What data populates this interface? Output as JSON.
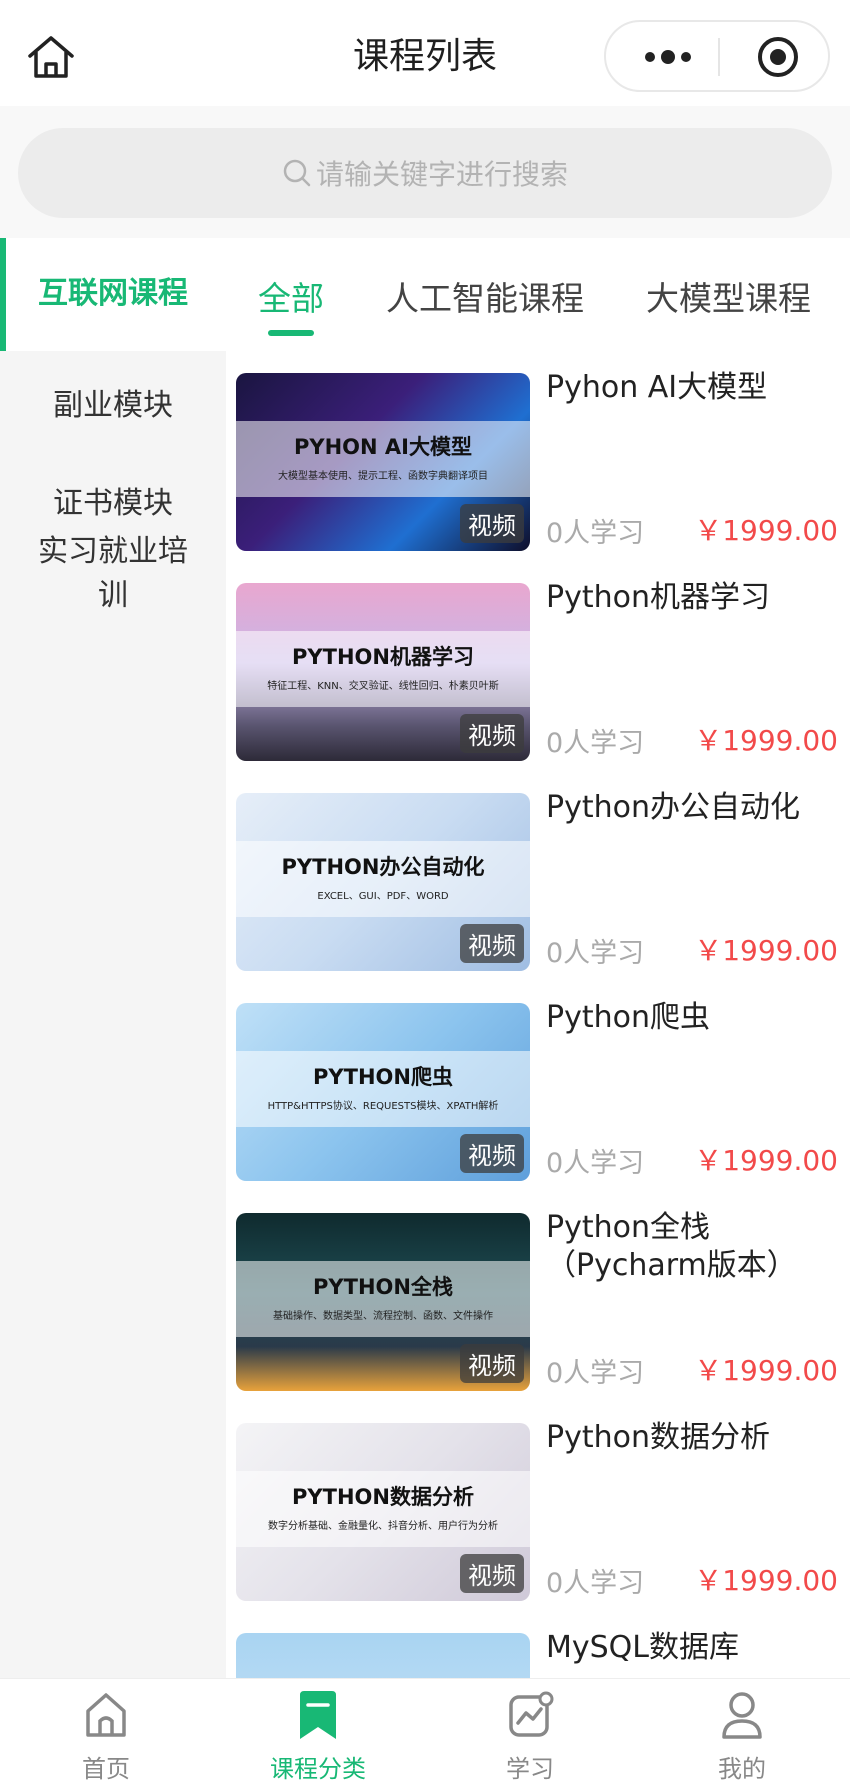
{
  "header": {
    "title": "课程列表"
  },
  "search": {
    "placeholder": "请输关键字进行搜索"
  },
  "sidebar": {
    "active": "互联网课程",
    "items": [
      "副业模块",
      "证书模块",
      "实习就业培训"
    ]
  },
  "subtabs": [
    "全部",
    "人工智能课程",
    "大模型课程"
  ],
  "courses": [
    {
      "title": "Pyhon AI大模型",
      "thumb_title": "PYHON AI大模型",
      "thumb_sub": "大模型基本使用、提示工程、函数字典翻译项目",
      "badge": "视频",
      "students": "0人学习",
      "price": "￥1999.00"
    },
    {
      "title": "Python机器学习",
      "thumb_title": "PYTHON机器学习",
      "thumb_sub": "特征工程、KNN、交叉验证、线性回归、朴素贝叶斯",
      "badge": "视频",
      "students": "0人学习",
      "price": "￥1999.00"
    },
    {
      "title": "Python办公自动化",
      "thumb_title": "PYTHON办公自动化",
      "thumb_sub": "EXCEL、GUI、PDF、WORD",
      "badge": "视频",
      "students": "0人学习",
      "price": "￥1999.00"
    },
    {
      "title": "Python爬虫",
      "thumb_title": "PYTHON爬虫",
      "thumb_sub": "HTTP&HTTPS协议、REQUESTS模块、XPATH解析",
      "badge": "视频",
      "students": "0人学习",
      "price": "￥1999.00"
    },
    {
      "title": "Python全栈（Pycharm版本）",
      "thumb_title": "PYTHON全栈",
      "thumb_sub": "基础操作、数据类型、流程控制、函数、文件操作",
      "badge": "视频",
      "students": "0人学习",
      "price": "￥1999.00"
    },
    {
      "title": "Python数据分析",
      "thumb_title": "PYTHON数据分析",
      "thumb_sub": "数字分析基础、金融量化、抖音分析、用户行为分析",
      "badge": "视频",
      "students": "0人学习",
      "price": "￥1999.00"
    },
    {
      "title": "MySQL数据库",
      "thumb_title": "",
      "thumb_sub": "",
      "badge": "",
      "students": "",
      "price": ""
    }
  ],
  "tabbar": [
    "首页",
    "课程分类",
    "学习",
    "我的"
  ],
  "colors": {
    "accent": "#18b875",
    "price": "#f24a4a"
  }
}
